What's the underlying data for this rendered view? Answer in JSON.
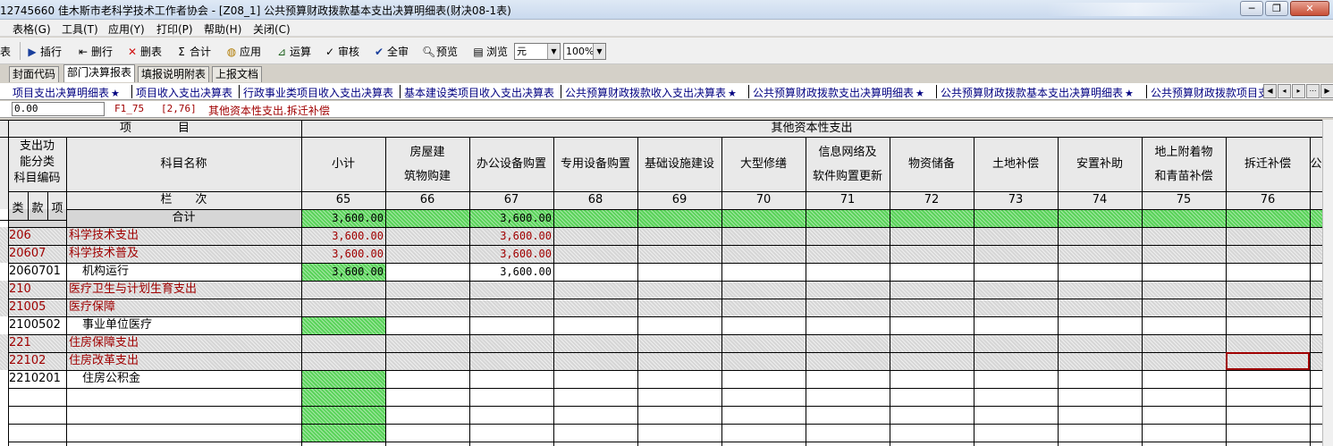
{
  "window": {
    "title": "12745660 佳木斯市老科学技术工作者协会 - [Z08_1] 公共预算财政拨款基本支出决算明细表(财决08-1表)",
    "buttons": [
      "─",
      "❐",
      "✕"
    ]
  },
  "menu": [
    "表格(G)",
    "工具(T)",
    "应用(Y)",
    "打印(P)",
    "帮助(H)",
    "关闭(C)"
  ],
  "toolbar": {
    "partial_label": "表",
    "buttons": [
      {
        "label": "插行",
        "icon": "insert-row-icon"
      },
      {
        "label": "删行",
        "icon": "delete-row-icon"
      },
      {
        "label": "删表",
        "icon": "delete-table-icon"
      },
      {
        "label": "合计",
        "icon": "sum-icon"
      },
      {
        "label": "应用",
        "icon": "apply-icon"
      },
      {
        "label": "运算",
        "icon": "calculate-icon"
      },
      {
        "label": "审核",
        "icon": "audit-icon"
      },
      {
        "label": "全审",
        "icon": "full-audit-icon"
      },
      {
        "label": "预览",
        "icon": "preview-icon"
      },
      {
        "label": "浏览",
        "icon": "browse-icon"
      }
    ],
    "unit": "元",
    "zoom": "100%"
  },
  "main_tabs": [
    "封面代码",
    "部门决算报表",
    "填报说明附表",
    "上报文档"
  ],
  "active_main_tab": 1,
  "sub_tabs": [
    {
      "label": "项目支出决算明细表",
      "star": true
    },
    {
      "label": "项目收入支出决算表",
      "star": false
    },
    {
      "label": "行政事业类项目收入支出决算表",
      "star": false
    },
    {
      "label": "基本建设类项目收入支出决算表",
      "star": false
    },
    {
      "label": "公共预算财政拨款收入支出决算表",
      "star": true
    },
    {
      "label": "公共预算财政拨款支出决算明细表",
      "star": true
    },
    {
      "label": "公共预算财政拨款基本支出决算明细表",
      "star": true
    },
    {
      "label": "公共预算财政拨款项目支",
      "star": false
    }
  ],
  "formula_bar": {
    "value": "0.00",
    "cell_ref": "F1_75",
    "coord": "[2,76]",
    "description": "其他资本性支出.拆迁补偿"
  },
  "grid": {
    "header_item": "项　　　　目",
    "header_group": "其他资本性支出",
    "func_code": "支出功\n能分类\n科目编码",
    "subject_name": "科目名称",
    "lanci": "栏　　次",
    "kuan_labels": [
      "类",
      "款",
      "项"
    ],
    "total_label": "合计",
    "columns": [
      {
        "name": "小计",
        "no": "65"
      },
      {
        "name": "房屋建\n筑物购建",
        "no": "66"
      },
      {
        "name": "办公设备购置",
        "no": "67"
      },
      {
        "name": "专用设备购置",
        "no": "68"
      },
      {
        "name": "基础设施建设",
        "no": "69"
      },
      {
        "name": "大型修缮",
        "no": "70"
      },
      {
        "name": "信息网络及\n软件购置更新",
        "no": "71"
      },
      {
        "name": "物资储备",
        "no": "72"
      },
      {
        "name": "土地补偿",
        "no": "73"
      },
      {
        "name": "安置补助",
        "no": "74"
      },
      {
        "name": "地上附着物\n和青苗补偿",
        "no": "75"
      },
      {
        "name": "拆迁补偿",
        "no": "76"
      },
      {
        "name": "公",
        "no": ""
      }
    ],
    "total_row": {
      "c65": "3,600.00",
      "c67": "3,600.00"
    },
    "rows": [
      {
        "code": "206",
        "name": "科学技术支出",
        "c65": "3,600.00",
        "c67": "3,600.00",
        "style": "cat"
      },
      {
        "code": "20607",
        "name": "科学技术普及",
        "c65": "3,600.00",
        "c67": "3,600.00",
        "style": "sub"
      },
      {
        "code": "2060701",
        "name": "机构运行",
        "c65": "3,600.00",
        "c67": "3,600.00",
        "style": "item"
      },
      {
        "code": "210",
        "name": "医疗卫生与计划生育支出",
        "c65": "",
        "c67": "",
        "style": "cat"
      },
      {
        "code": "21005",
        "name": "医疗保障",
        "c65": "",
        "c67": "",
        "style": "sub"
      },
      {
        "code": "2100502",
        "name": "事业单位医疗",
        "c65": "",
        "c67": "",
        "style": "item"
      },
      {
        "code": "221",
        "name": "住房保障支出",
        "c65": "",
        "c67": "",
        "style": "cat"
      },
      {
        "code": "22102",
        "name": "住房改革支出",
        "c65": "",
        "c67": "",
        "style": "sub"
      },
      {
        "code": "2210201",
        "name": "住房公积金",
        "c65": "",
        "c67": "",
        "style": "item"
      }
    ]
  },
  "colors": {
    "red_text": "#a00000",
    "green_cell": "#5ad35a",
    "navy_tab": "#000080"
  }
}
